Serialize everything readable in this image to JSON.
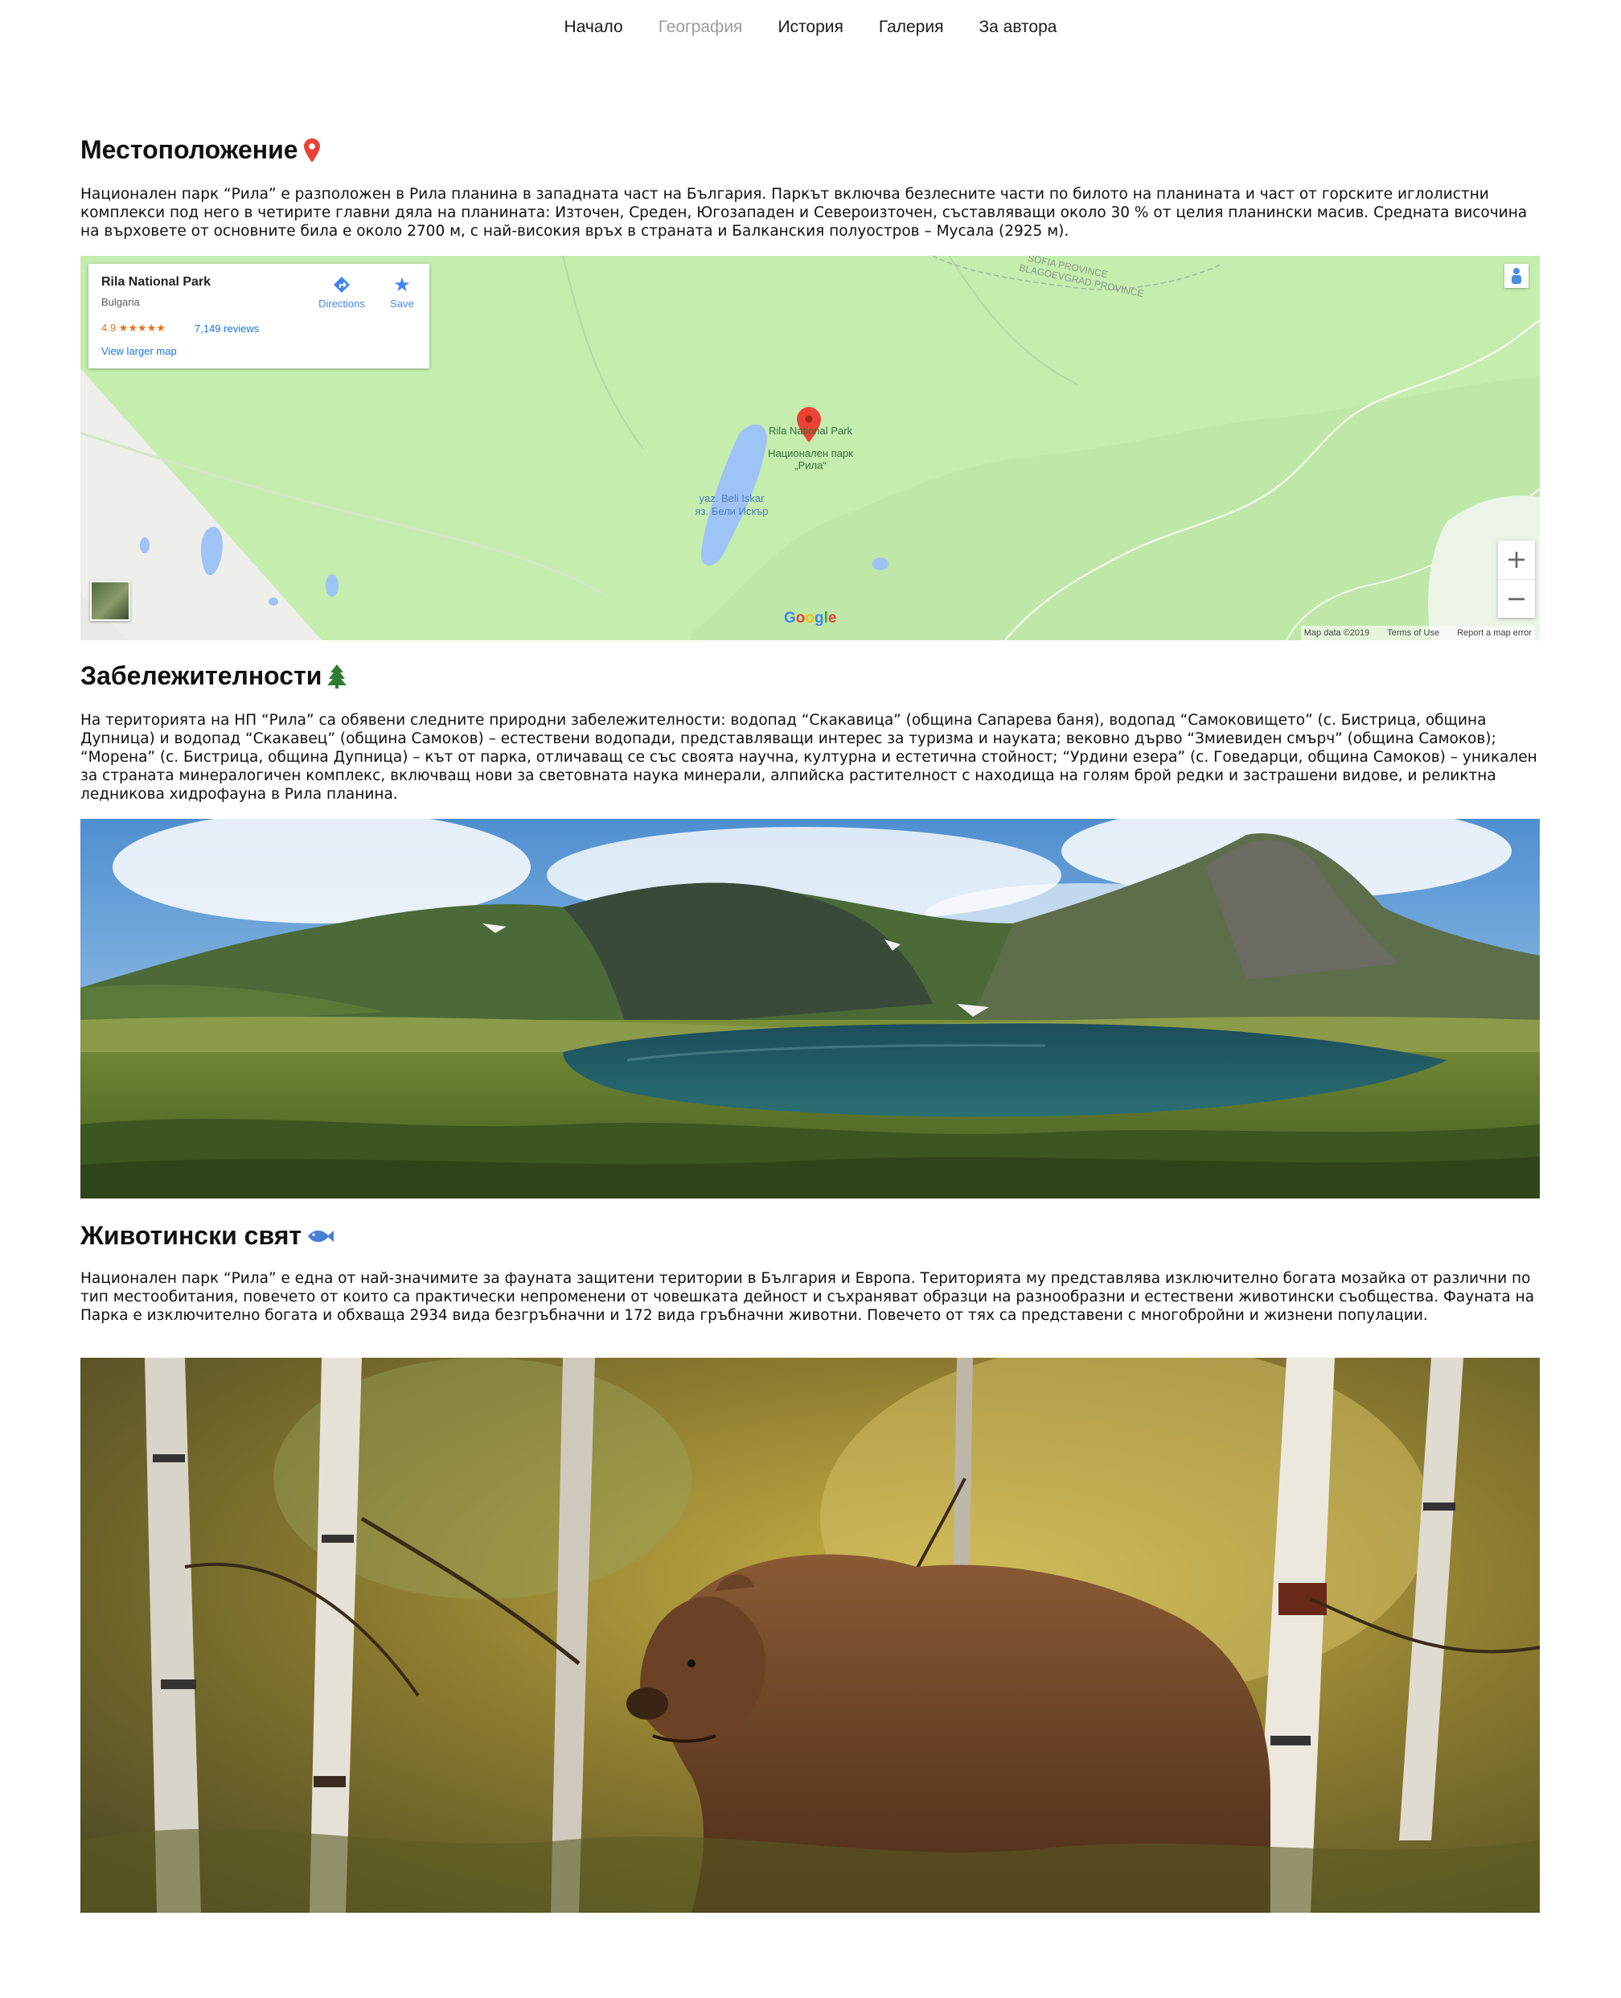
{
  "nav": {
    "items": [
      {
        "label": "Начало",
        "active": false
      },
      {
        "label": "География",
        "active": true
      },
      {
        "label": "История",
        "active": false
      },
      {
        "label": "Галерия",
        "active": false
      },
      {
        "label": "За автора",
        "active": false
      }
    ]
  },
  "sections": {
    "location": {
      "title": "Местоположение",
      "icon": "map-pin-icon",
      "text": "Национален парк “Рила” е разположен в Рила планина в западната част на България. Паркът включва безлесните части по билото на планината и част от горските иглолистни комплекси под него в четирите главни дяла на планината: Източен, Среден, Югозападен и Североизточен, съставляващи около 30 % от целия планински масив. Средната височина на върховете от основните била е около 2700 м, с най-високия връх в страната и Балканския полуостров – Мусала (2925 м)."
    },
    "landmarks": {
      "title": "Забележителности",
      "icon": "tree-icon",
      "text": "На територията на НП “Рила” са обявени следните природни забележителности: водопад “Скакавица” (община Сапарева баня), водопад “Самоковището” (с. Бистрица, община Дупница) и водопад “Скакавец” (община Самоков) – естествени водопади, представляващи интерес за туризма и науката; вековно дърво “Змиевиден смърч” (община Самоков); “Морена” (с. Бистрица, община Дупница) – кът от парка, отличаващ се със своята научна, културна и естетична стойност; “Урдини езера” (с. Говедарци, община Самоков) – уникален за страната минералогичен комплекс, включващ нови за световната наука минерали, алпийска растителност с находища на голям брой редки и застрашени видове, и реликтна ледникова хидрофауна в Рила планина."
    },
    "fauna": {
      "title": "Животински свят",
      "icon": "fish-icon",
      "text": "Национален парк “Рила” е една от най-значимите за фауната защитени територии в България и Европа. Територията му представлява изключително богата мозайка от различни по тип местообитания, повечето от които са практически непроменени от човешката дейност и съхраняват образци на разнообразни и естествени животински съобщества. Фауната на Парка е изключително богата и обхваща 2934 вида безгръбначни и 172 вида гръбначни животни. Повечето от тях са представени с многобройни и жизнени популации."
    }
  },
  "map": {
    "place_name": "Rila National Park",
    "country": "Bulgaria",
    "rating": "4.9 ★★★★★",
    "reviews": "7,149 reviews",
    "directions": "Directions",
    "save": "Save",
    "view_larger": "View larger map",
    "labels": {
      "province1": "SOFIA PROVINCE",
      "province2": "BLAGOEVGRAD PROVINCE",
      "pin_en": "Rila National Park",
      "pin_bg": "Национален парк „Рила“",
      "lake_en": "yaz. Beli Iskar",
      "lake_bg": "яз. Бели Искър"
    },
    "zoom_in": "+",
    "zoom_out": "−",
    "google": "Google",
    "attribution": {
      "map_data": "Map data ©2019",
      "terms": "Terms of Use",
      "report": "Report a map error"
    }
  },
  "colors": {
    "nav_active": "#9c9c9c",
    "map_green": "#c4edae",
    "map_water": "#9ec3f7",
    "pin_red": "#ea4335",
    "tree_green": "#2e7d32",
    "fish_blue": "#4a7fd4"
  }
}
